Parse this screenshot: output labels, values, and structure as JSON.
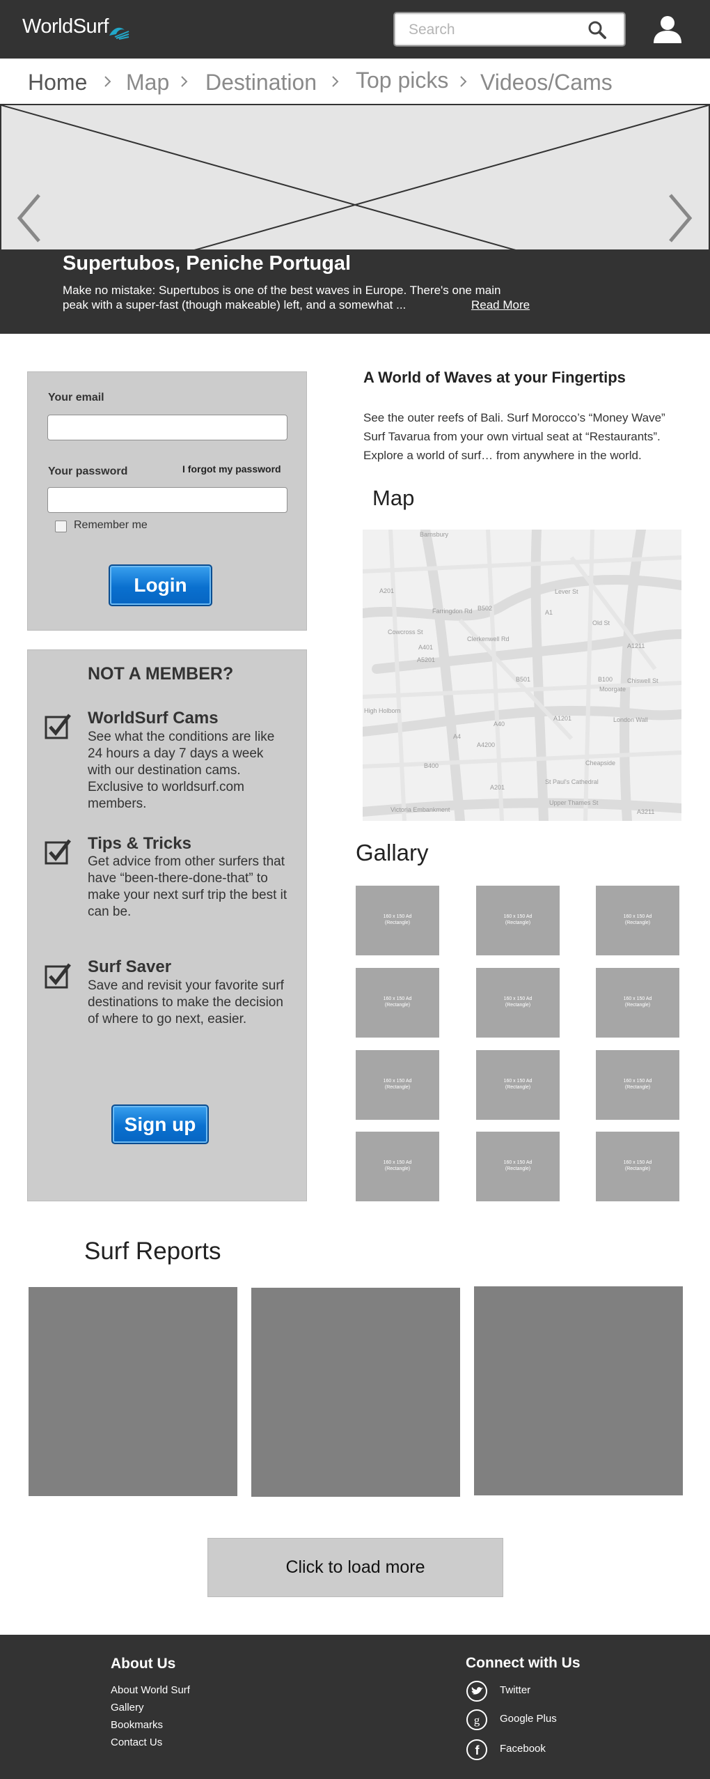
{
  "header": {
    "logo": "WorldSurf",
    "search_placeholder": "Search"
  },
  "breadcrumb": [
    "Home",
    "Map",
    "Destination",
    "Top picks",
    "Videos/Cams"
  ],
  "hero": {
    "title": "Supertubos, Peniche Portugal",
    "text": "Make no mistake: Supertubos is one of the best waves in Europe. There's one main peak with a super-fast (though makeable) left, and a somewhat ...",
    "read_more": "Read More"
  },
  "login": {
    "email_label": "Your email",
    "password_label": "Your password",
    "forgot_label": "I forgot my password",
    "remember_label": "Remember me",
    "button_label": "Login"
  },
  "member": {
    "title": "NOT A MEMBER?",
    "features": [
      {
        "title": "WorldSurf Cams",
        "desc": "See what the conditions are like 24 hours a day 7 days a week with our destination cams. Exclusive to worldsurf.com members."
      },
      {
        "title": "Tips & Tricks",
        "desc": "Get advice from other surfers that have “been-there-done-that” to make your next surf trip the best it can be."
      },
      {
        "title": "Surf Saver",
        "desc": "Save and revisit your favorite surf destinations to make the decision of where to go next, easier."
      }
    ],
    "signup_label": "Sign up"
  },
  "intro": {
    "title": "A World of Waves at your Fingertips",
    "text": "See the outer reefs of Bali. Surf Morocco’s “Money Wave” Surf Tavarua from your own virtual seat at “Restaurants”. Explore a world of surf… from anywhere in the world."
  },
  "map": {
    "title": "Map",
    "labels": [
      "Barnsbury",
      "A201",
      "B502",
      "A1",
      "A401",
      "A5201",
      "B501",
      "A1201",
      "B100",
      "Moorgate",
      "A40",
      "A4",
      "A4200",
      "B400",
      "A1211",
      "A3211",
      "A201",
      "St Paul's Cathedral",
      "Upper Thames St",
      "Victoria Embankment",
      "High Holborn",
      "Old St",
      "Lever St",
      "Clerkenwell Rd",
      "Chiswell St",
      "London Wall",
      "Cheapside",
      "Farringdon Rd",
      "Cowcross St"
    ]
  },
  "gallery": {
    "title": "Gallary",
    "thumb_line1": "160 x 150 Ad",
    "thumb_line2": "(Rectangle)",
    "count": 12
  },
  "reports": {
    "title": "Surf Reports",
    "load_more": "Click to load more"
  },
  "footer": {
    "about_heading": "About Us",
    "about_links": [
      "About World Surf",
      "Gallery",
      "Bookmarks",
      "Contact Us"
    ],
    "connect_heading": "Connect with Us",
    "social": [
      {
        "icon": "twitter-icon",
        "label": "Twitter"
      },
      {
        "icon": "google-plus-icon",
        "label": "Google Plus"
      },
      {
        "icon": "facebook-icon",
        "label": "Facebook"
      }
    ]
  },
  "colors": {
    "dark": "#333333",
    "panel": "#cccccc",
    "button_blue": "#0a70cf",
    "thumb": "#a6a6a6",
    "report_card": "#808080"
  }
}
